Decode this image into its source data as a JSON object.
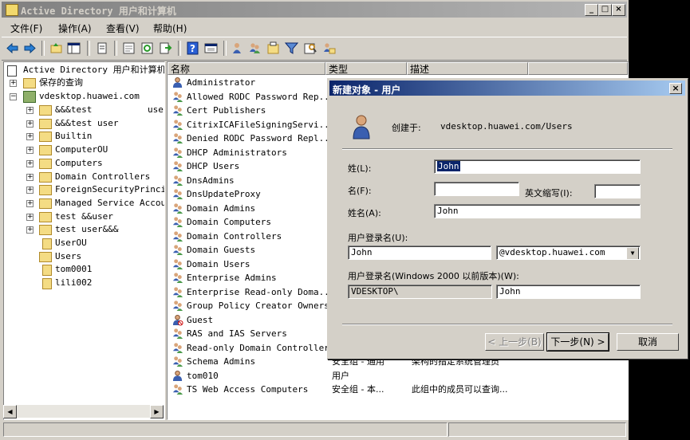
{
  "window": {
    "title": "Active Directory 用户和计算机"
  },
  "menu": [
    "文件(F)",
    "操作(A)",
    "查看(V)",
    "帮助(H)"
  ],
  "toolbar_icons": [
    "back-arrow-icon",
    "forward-arrow-icon",
    "up-folder-icon",
    "show-tree-icon",
    "copy-icon",
    "properties-icon",
    "refresh-icon",
    "export-icon",
    "help-icon",
    "console-icon",
    "new-user-icon",
    "new-group-icon",
    "new-ou-icon",
    "filter-icon",
    "find-icon",
    "delegate-icon"
  ],
  "tree": {
    "root": "Active Directory 用户和计算机",
    "saved_queries": "保存的查询",
    "domain": "vdesktop.huawei.com",
    "items": [
      {
        "label": "&&&test",
        "suffix": "use",
        "type": "folder",
        "expander": "+"
      },
      {
        "label": "&&&test  user",
        "type": "folder",
        "expander": "+"
      },
      {
        "label": "Builtin",
        "type": "folder",
        "expander": "+"
      },
      {
        "label": "ComputerOU",
        "type": "folder",
        "expander": "+"
      },
      {
        "label": "Computers",
        "type": "folder",
        "expander": "+"
      },
      {
        "label": "Domain Controllers",
        "type": "folder",
        "expander": "+"
      },
      {
        "label": "ForeignSecurityPrincip",
        "type": "folder",
        "expander": "+"
      },
      {
        "label": "Managed Service Accour",
        "type": "folder",
        "expander": "+"
      },
      {
        "label": "test   &&user",
        "type": "folder",
        "expander": "+"
      },
      {
        "label": "test   user&&&",
        "type": "folder",
        "expander": "+"
      },
      {
        "label": "UserOU",
        "type": "ou",
        "expander": ""
      },
      {
        "label": "Users",
        "type": "folder",
        "expander": "",
        "selected": true
      },
      {
        "label": "tom0001",
        "type": "ou",
        "expander": ""
      },
      {
        "label": "lili002",
        "type": "ou",
        "expander": ""
      }
    ]
  },
  "list": {
    "headers": {
      "name": "名称",
      "type": "类型",
      "desc": "描述"
    },
    "rows": [
      {
        "name": "Administrator",
        "icon": "user",
        "type": "",
        "desc": ""
      },
      {
        "name": "Allowed RODC Password Rep...",
        "icon": "group",
        "type": "",
        "desc": ""
      },
      {
        "name": "Cert Publishers",
        "icon": "group",
        "type": "",
        "desc": ""
      },
      {
        "name": "CitrixICAFileSigningServi...",
        "icon": "group",
        "type": "",
        "desc": ""
      },
      {
        "name": "Denied RODC Password Repl...",
        "icon": "group",
        "type": "",
        "desc": ""
      },
      {
        "name": "DHCP Administrators",
        "icon": "group",
        "type": "",
        "desc": ""
      },
      {
        "name": "DHCP Users",
        "icon": "group",
        "type": "",
        "desc": ""
      },
      {
        "name": "DnsAdmins",
        "icon": "group",
        "type": "",
        "desc": ""
      },
      {
        "name": "DnsUpdateProxy",
        "icon": "group",
        "type": "",
        "desc": ""
      },
      {
        "name": "Domain Admins",
        "icon": "group",
        "type": "",
        "desc": ""
      },
      {
        "name": "Domain Computers",
        "icon": "group",
        "type": "",
        "desc": ""
      },
      {
        "name": "Domain Controllers",
        "icon": "group",
        "type": "",
        "desc": ""
      },
      {
        "name": "Domain Guests",
        "icon": "group",
        "type": "",
        "desc": ""
      },
      {
        "name": "Domain Users",
        "icon": "group",
        "type": "",
        "desc": ""
      },
      {
        "name": "Enterprise Admins",
        "icon": "group",
        "type": "",
        "desc": ""
      },
      {
        "name": "Enterprise Read-only Doma...",
        "icon": "group",
        "type": "",
        "desc": ""
      },
      {
        "name": "Group Policy Creator Owners",
        "icon": "group",
        "type": "",
        "desc": ""
      },
      {
        "name": "Guest",
        "icon": "user-disabled",
        "type": "",
        "desc": ""
      },
      {
        "name": "RAS and IAS Servers",
        "icon": "group",
        "type": "",
        "desc": ""
      },
      {
        "name": "Read-only Domain Controllers",
        "icon": "group",
        "type": "",
        "desc": ""
      },
      {
        "name": "Schema Admins",
        "icon": "group",
        "type": "安全组 - 通用",
        "desc": "架构的指定系统管理员"
      },
      {
        "name": "tom010",
        "icon": "user",
        "type": "用户",
        "desc": ""
      },
      {
        "name": "TS Web Access Computers",
        "icon": "group",
        "type": "安全组 - 本...",
        "desc": "此组中的成员可以查询..."
      }
    ]
  },
  "dialog": {
    "title": "新建对象 - 用户",
    "created_in_label": "创建于:",
    "created_in_value": "vdesktop.huawei.com/Users",
    "last_name_label": "姓(L):",
    "last_name_value": "John",
    "first_name_label": "名(F):",
    "first_name_value": "",
    "initials_label": "英文缩写(I):",
    "initials_value": "",
    "full_name_label": "姓名(A):",
    "full_name_value": "John",
    "logon_label": "用户登录名(U):",
    "logon_value": "John",
    "upn_suffix": "@vdesktop.huawei.com",
    "pre2000_label": "用户登录名(Windows 2000 以前版本)(W):",
    "pre2000_domain": "VDESKTOP\\",
    "pre2000_value": "John",
    "back_button": "< 上一步(B)",
    "next_button": "下一步(N) >",
    "cancel_button": "取消"
  },
  "colors": {
    "dialog_title_start": "#0a246a",
    "dialog_title_end": "#a6caf0",
    "inactive_title_start": "#808080",
    "face": "#d4d0c8"
  }
}
